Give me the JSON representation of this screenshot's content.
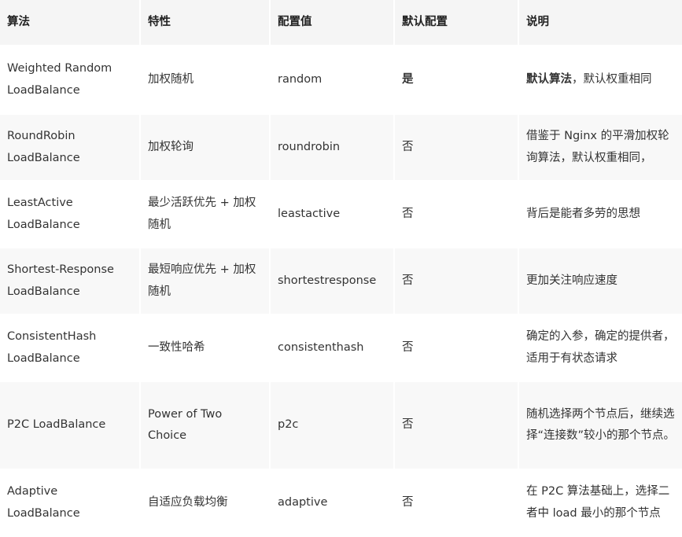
{
  "headers": [
    "算法",
    "特性",
    "配置值",
    "默认配置",
    "说明"
  ],
  "rows": [
    {
      "algo": "Weighted Random LoadBalance",
      "feature": "加权随机",
      "config": "random",
      "default": "是",
      "desc_strong": "默认算法",
      "desc": "，默认权重相同"
    },
    {
      "algo": "RoundRobin LoadBalance",
      "feature": "加权轮询",
      "config": "roundrobin",
      "default": "否",
      "desc": "借鉴于 Nginx 的平滑加权轮询算法，默认权重相同，"
    },
    {
      "algo": "LeastActive LoadBalance",
      "feature": "最少活跃优先 + 加权随机",
      "config": "leastactive",
      "default": "否",
      "desc": "背后是能者多劳的思想"
    },
    {
      "algo": "Shortest-Response LoadBalance",
      "feature": "最短响应优先 + 加权随机",
      "config": "shortestresponse",
      "default": "否",
      "desc": "更加关注响应速度"
    },
    {
      "algo": "ConsistentHash LoadBalance",
      "feature": "一致性哈希",
      "config": "consistenthash",
      "default": "否",
      "desc": "确定的入参，确定的提供者，适用于有状态请求"
    },
    {
      "algo": "P2C LoadBalance",
      "feature": "Power of Two Choice",
      "config": "p2c",
      "default": "否",
      "desc": "随机选择两个节点后，继续选择“连接数”较小的那个节点。"
    },
    {
      "algo": "Adaptive LoadBalance",
      "feature": "自适应负载均衡",
      "config": "adaptive",
      "default": "否",
      "desc": "在 P2C 算法基础上，选择二者中 load 最小的那个节点"
    }
  ]
}
